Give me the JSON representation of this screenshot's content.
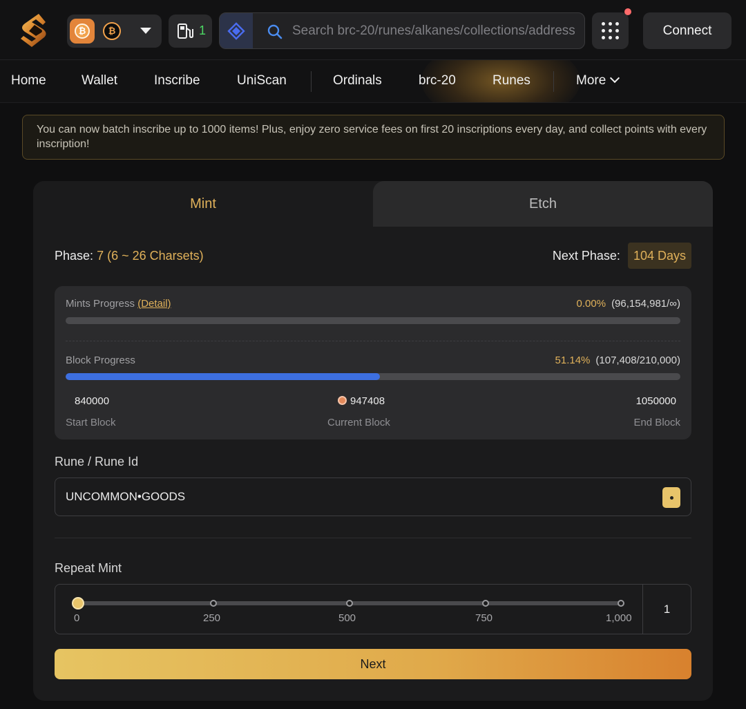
{
  "header": {
    "search_placeholder": "Search brc-20/runes/alkanes/collections/address",
    "gas_count": "1",
    "btc_symbol": "₿",
    "connect_label": "Connect"
  },
  "nav": {
    "items": [
      "Home",
      "Wallet",
      "Inscribe",
      "UniScan",
      "Ordinals",
      "brc-20",
      "Runes",
      "More"
    ]
  },
  "banner": {
    "text": "You can now batch inscribe up to 1000 items! Plus, enjoy zero service fees on first 20 inscriptions every day, and collect points with every inscription!"
  },
  "tabs": {
    "mint": "Mint",
    "etch": "Etch",
    "active": "Mint"
  },
  "phase": {
    "label": "Phase:",
    "value": "7 (6 ~ 26 Charsets)",
    "next_label": "Next Phase:",
    "next_value": "104 Days"
  },
  "mints_progress": {
    "label": "Mints Progress",
    "detail_label": "(Detail)",
    "percent": "0.00%",
    "counts": "(96,154,981/∞)",
    "fraction": 0.0
  },
  "block_progress": {
    "label": "Block Progress",
    "percent": "51.14%",
    "counts": "(107,408/210,000)",
    "fraction": 0.5114,
    "start_block": "840000",
    "start_label": "Start Block",
    "current_block": "947408",
    "current_label": "Current Block",
    "end_block": "1050000",
    "end_label": "End Block"
  },
  "rune": {
    "label": "Rune / Rune Id",
    "value": "UNCOMMON•GOODS"
  },
  "repeat_mint": {
    "label": "Repeat Mint",
    "ticks": [
      "0",
      "250",
      "500",
      "750",
      "1,000"
    ],
    "value": "1"
  },
  "next_label": "Next",
  "colors": {
    "accent_gold": "#e0b15a",
    "progress_blue": "#3d6fe0",
    "connect_bg": "#2a2a2c"
  }
}
